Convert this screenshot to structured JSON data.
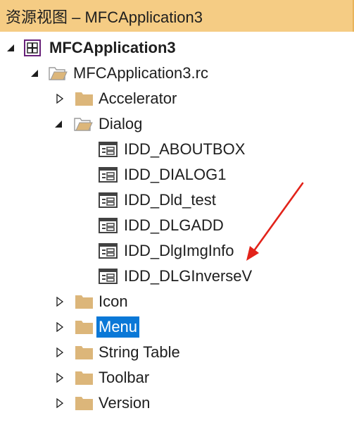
{
  "window": {
    "title": "资源视图 – MFCApplication3"
  },
  "tree": {
    "project": "MFCApplication3",
    "rc_file": "MFCApplication3.rc",
    "accelerator": "Accelerator",
    "dialog": "Dialog",
    "dialogs": [
      "IDD_ABOUTBOX",
      "IDD_DIALOG1",
      "IDD_Dld_test",
      "IDD_DLGADD",
      "IDD_DlgImgInfo",
      "IDD_DLGInverseV"
    ],
    "icon": "Icon",
    "menu": "Menu",
    "string_table": "String Table",
    "toolbar": "Toolbar",
    "version": "Version"
  },
  "colors": {
    "titlebar": "#f5cc84",
    "selection": "#0a78d7",
    "folder": "#dcb67a",
    "project_icon": "#68217a",
    "arrow": "#e2231a"
  }
}
